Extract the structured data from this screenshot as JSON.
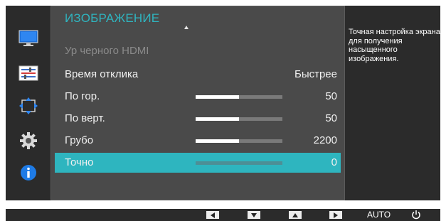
{
  "menu": {
    "title": "ИЗОБРАЖЕНИЕ",
    "rows": [
      {
        "label": "Ур черного HDMI",
        "value": "",
        "dim": true
      },
      {
        "label": "Время отклика",
        "value": "Быстрее"
      },
      {
        "label": "По гор.",
        "value": "50",
        "level": 0.5
      },
      {
        "label": "По верт.",
        "value": "50",
        "level": 0.5
      },
      {
        "label": "Грубо",
        "value": "2200",
        "level": 0.5
      },
      {
        "label": "Точно",
        "value": "0",
        "level": 0,
        "selected": true
      }
    ]
  },
  "help": {
    "text": "Точная настройка экрана для получения насыщенного изображения."
  },
  "sidebar": {
    "icons": [
      "monitor-icon",
      "sliders-icon",
      "arrows-move-icon",
      "gear-icon",
      "info-icon"
    ]
  },
  "bottom": {
    "buttons": [
      "left-arrow",
      "down-arrow",
      "up-arrow",
      "right-arrow"
    ],
    "auto_label": "AUTO"
  },
  "colors": {
    "accent": "#2eb5bf",
    "background": "#2b2b2b",
    "panel": "#4a4a4a"
  }
}
